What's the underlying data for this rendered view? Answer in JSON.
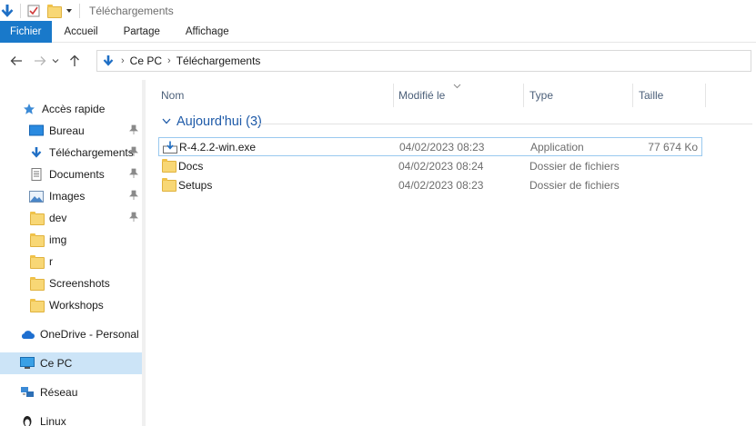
{
  "window": {
    "title": "Téléchargements"
  },
  "ribbon": {
    "tabs": [
      "Fichier",
      "Accueil",
      "Partage",
      "Affichage"
    ]
  },
  "address": {
    "crumbs": [
      "Ce PC",
      "Téléchargements"
    ]
  },
  "sidebar": {
    "quick_access": "Accès rapide",
    "items": [
      {
        "label": "Bureau",
        "icon": "desktop-icon",
        "pinned": true
      },
      {
        "label": "Téléchargements",
        "icon": "download-icon",
        "pinned": true
      },
      {
        "label": "Documents",
        "icon": "documents-icon",
        "pinned": true
      },
      {
        "label": "Images",
        "icon": "images-icon",
        "pinned": true
      },
      {
        "label": "dev",
        "icon": "folder-icon",
        "pinned": true
      },
      {
        "label": "img",
        "icon": "folder-icon",
        "pinned": false
      },
      {
        "label": "r",
        "icon": "folder-icon",
        "pinned": false
      },
      {
        "label": "Screenshots",
        "icon": "folder-icon",
        "pinned": false
      },
      {
        "label": "Workshops",
        "icon": "folder-icon",
        "pinned": false
      }
    ],
    "onedrive": "OneDrive - Personal",
    "this_pc": "Ce PC",
    "network": "Réseau",
    "linux": "Linux"
  },
  "columns": {
    "name": "Nom",
    "modified": "Modifié le",
    "type": "Type",
    "size": "Taille"
  },
  "group": {
    "label": "Aujourd'hui (3)"
  },
  "files": [
    {
      "name": "R-4.2.2-win.exe",
      "modified": "04/02/2023 08:23",
      "type": "Application",
      "size": "77 674 Ko",
      "icon": "installer-icon"
    },
    {
      "name": "Docs",
      "modified": "04/02/2023 08:24",
      "type": "Dossier de fichiers",
      "size": "",
      "icon": "folder-icon"
    },
    {
      "name": "Setups",
      "modified": "04/02/2023 08:23",
      "type": "Dossier de fichiers",
      "size": "",
      "icon": "folder-icon"
    }
  ],
  "colors": {
    "accent": "#1979ca",
    "group_text": "#1e5aa8",
    "selection": "#cce4f7",
    "folder": "#f8d775"
  }
}
